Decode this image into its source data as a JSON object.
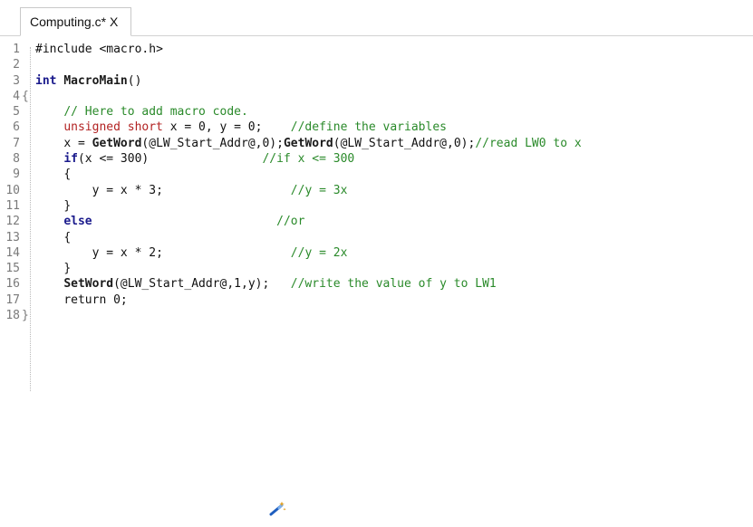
{
  "tab": {
    "title": "Computing.c*",
    "close": "X"
  },
  "code": {
    "lines": [
      {
        "n": "1",
        "fold": ""
      },
      {
        "n": "2",
        "fold": ""
      },
      {
        "n": "3",
        "fold": ""
      },
      {
        "n": "4",
        "fold": "{"
      },
      {
        "n": "5",
        "fold": ""
      },
      {
        "n": "6",
        "fold": ""
      },
      {
        "n": "7",
        "fold": ""
      },
      {
        "n": "8",
        "fold": ""
      },
      {
        "n": "9",
        "fold": ""
      },
      {
        "n": "10",
        "fold": ""
      },
      {
        "n": "11",
        "fold": ""
      },
      {
        "n": "12",
        "fold": ""
      },
      {
        "n": "13",
        "fold": ""
      },
      {
        "n": "14",
        "fold": ""
      },
      {
        "n": "15",
        "fold": ""
      },
      {
        "n": "16",
        "fold": ""
      },
      {
        "n": "17",
        "fold": ""
      },
      {
        "n": "18",
        "fold": "}"
      }
    ],
    "l1": {
      "a": "#include ",
      "b": "<macro.h>"
    },
    "l3": {
      "kw": "int",
      "fn": "MacroMain",
      "rest": "()"
    },
    "l5": {
      "cm": "// Here to add macro code."
    },
    "l6": {
      "kw": "unsigned short",
      "code": " x = 0, y = 0;",
      "cm": "//define the variables"
    },
    "l7": {
      "a": "x = ",
      "f1": "GetWord",
      "b": "(@LW_Start_Addr@,0);",
      "f2": "GetWord",
      "c": "(@LW_Start_Addr@,0);",
      "cm": "//read LW0 to x"
    },
    "l8": {
      "kw": "if",
      "code": "(x <= 300)",
      "cm": "//if x <= 300"
    },
    "l9": {
      "code": "{"
    },
    "l10": {
      "code": "y = x * 3;",
      "cm": "//y = 3x"
    },
    "l11": {
      "code": "}"
    },
    "l12": {
      "kw": "else",
      "cm": "//or"
    },
    "l13": {
      "code": "{"
    },
    "l14": {
      "code": "y = x * 2;",
      "cm": "//y = 2x"
    },
    "l15": {
      "code": "}"
    },
    "l16": {
      "fn": "SetWord",
      "code": "(@LW_Start_Addr@,1,y);",
      "cm": "//write the value of y to LW1"
    },
    "l17": {
      "code": "return 0;"
    }
  },
  "icons": {
    "wand": "magic-wand-icon"
  }
}
